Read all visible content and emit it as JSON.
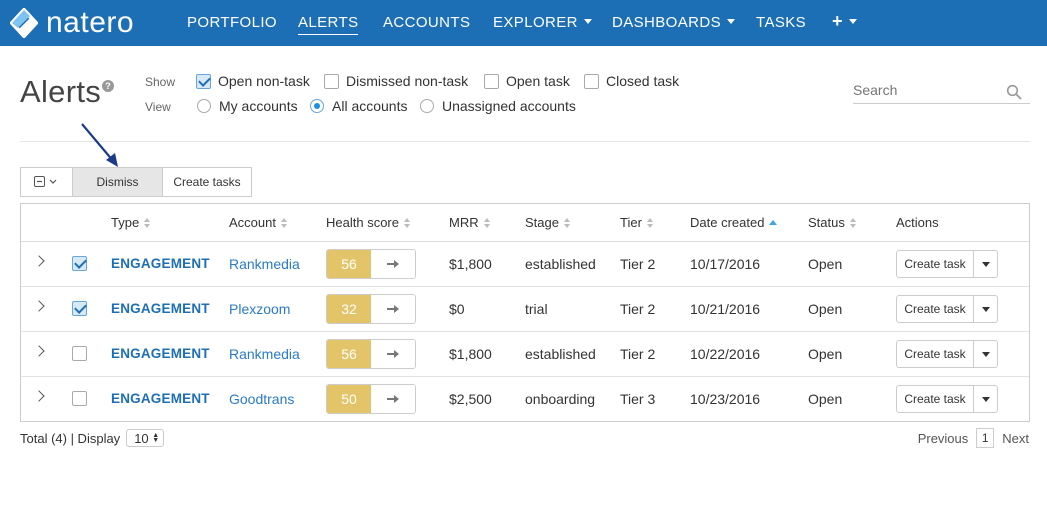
{
  "brand": {
    "name": "natero",
    "accent": "#1d6fb5"
  },
  "nav": {
    "items": [
      {
        "label": "PORTFOLIO"
      },
      {
        "label": "ALERTS"
      },
      {
        "label": "ACCOUNTS"
      },
      {
        "label": "EXPLORER"
      },
      {
        "label": "DASHBOARDS"
      },
      {
        "label": "TASKS"
      },
      {
        "label": "+"
      }
    ],
    "active": "ALERTS"
  },
  "header": {
    "title": "Alerts",
    "help_icon": "question-circle-icon",
    "show_label": "Show",
    "view_label": "View",
    "show_options": [
      {
        "label": "Open non-task",
        "checked": true
      },
      {
        "label": "Dismissed non-task",
        "checked": false
      },
      {
        "label": "Open task",
        "checked": false
      },
      {
        "label": "Closed task",
        "checked": false
      }
    ],
    "view_options": [
      {
        "label": "My accounts",
        "selected": false
      },
      {
        "label": "All accounts",
        "selected": true
      },
      {
        "label": "Unassigned accounts",
        "selected": false
      }
    ],
    "search_placeholder": "Search"
  },
  "toolbar": {
    "dismiss_label": "Dismiss",
    "create_tasks_label": "Create tasks"
  },
  "table": {
    "columns": [
      "Type",
      "Account",
      "Health score",
      "MRR",
      "Stage",
      "Tier",
      "Date created",
      "Status",
      "Actions"
    ],
    "sorted_column": "Date created",
    "rows": [
      {
        "checked": true,
        "type": "ENGAGEMENT",
        "account": "Rankmedia",
        "health": "56",
        "mrr": "$1,800",
        "stage": "established",
        "tier": "Tier 2",
        "date": "10/17/2016",
        "status": "Open",
        "action": "Create task"
      },
      {
        "checked": true,
        "type": "ENGAGEMENT",
        "account": "Plexzoom",
        "health": "32",
        "mrr": "$0",
        "stage": "trial",
        "tier": "Tier 2",
        "date": "10/21/2016",
        "status": "Open",
        "action": "Create task"
      },
      {
        "checked": false,
        "type": "ENGAGEMENT",
        "account": "Rankmedia",
        "health": "56",
        "mrr": "$1,800",
        "stage": "established",
        "tier": "Tier 2",
        "date": "10/22/2016",
        "status": "Open",
        "action": "Create task"
      },
      {
        "checked": false,
        "type": "ENGAGEMENT",
        "account": "Goodtrans",
        "health": "50",
        "mrr": "$2,500",
        "stage": "onboarding",
        "tier": "Tier 3",
        "date": "10/23/2016",
        "status": "Open",
        "action": "Create task"
      }
    ],
    "health_color": "#e3c468"
  },
  "footer": {
    "total_text": "Total (4) | Display",
    "display_value": "10",
    "previous_label": "Previous",
    "page": "1",
    "next_label": "Next"
  },
  "annotation": {
    "arrow_color": "#1a3a8a"
  }
}
